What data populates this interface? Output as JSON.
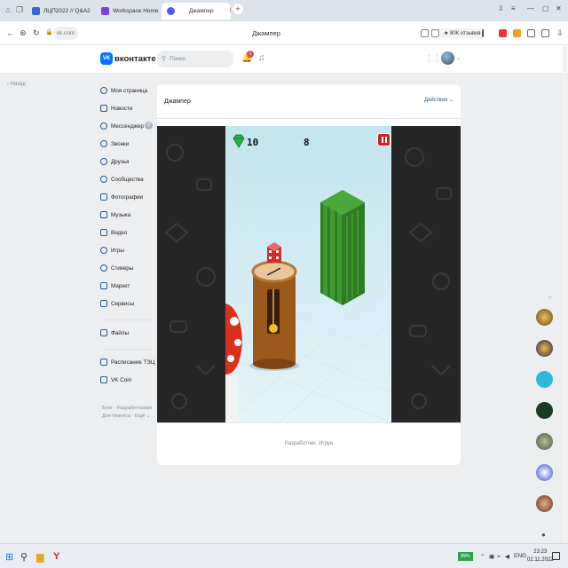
{
  "browser": {
    "tabs": [
      {
        "label": "ЛЦП2022 // Q&A2",
        "active": false
      },
      {
        "label": "Workspace Home",
        "active": false
      },
      {
        "label": "Джампер",
        "active": true,
        "extra": "ʬ"
      }
    ],
    "url": "vk.com",
    "page_title": "Джампер",
    "reviews_badge": "★ 80К отзывов"
  },
  "vk": {
    "logo_text": "VK",
    "brand": "вконтакте",
    "search_placeholder": "Поиск",
    "notifications_count": "1",
    "back_label": "Назад",
    "menu": [
      {
        "label": "Моя страница"
      },
      {
        "label": "Новости"
      },
      {
        "label": "Мессенджер",
        "badge": "3"
      },
      {
        "label": "Звонки"
      },
      {
        "label": "Друзья"
      },
      {
        "label": "Сообщества"
      },
      {
        "label": "Фотографии"
      },
      {
        "label": "Музыка"
      },
      {
        "label": "Видео"
      },
      {
        "label": "Игры"
      },
      {
        "label": "Стикеры"
      },
      {
        "label": "Маркет"
      },
      {
        "label": "Сервисы"
      },
      {
        "label": "Файлы"
      },
      {
        "label": "Расписание ТЭЦ"
      },
      {
        "label": "VK Coin"
      }
    ],
    "footer_links_1": "Блог · Разработчикам",
    "footer_links_2": "Для бизнеса · Ещё ⌄"
  },
  "app": {
    "title": "Джампер",
    "actions_label": "Действия ⌄",
    "developer_credit": "Разработчик: Игрун"
  },
  "game": {
    "gems": "10",
    "score": "8"
  },
  "taskbar": {
    "battery": "89%",
    "lang": "ENG",
    "time": "23:23",
    "date": "02.11.2022"
  },
  "colors": {
    "vk_blue": "#0077ff",
    "link_blue": "#2a5885",
    "pause_red": "#d02020",
    "gem_green": "#1fb34a"
  }
}
